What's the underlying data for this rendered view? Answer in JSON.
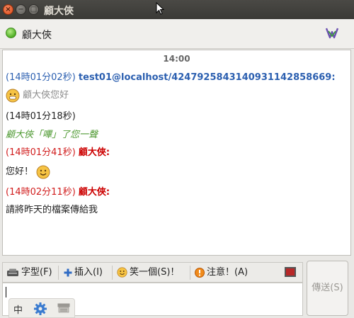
{
  "window": {
    "title": "顧大俠",
    "close_glyph": "×",
    "minimize_glyph": "−",
    "maximize_glyph": "□"
  },
  "contact": {
    "name": "顧大俠",
    "status_color": "#4fae25"
  },
  "chat": {
    "time_separator": "14:00",
    "messages": [
      {
        "stamp": "(14時01分02秒)",
        "sender": "test01@localhost/4247925843140931142858669:",
        "color": "blue"
      },
      {
        "text": "顧大俠您好",
        "emoticon": "grin",
        "color": "grey"
      },
      {
        "stamp": "(14時01分18秒)",
        "color": "dark"
      },
      {
        "text": "顧大俠「嗶」了您一聲",
        "color": "green"
      },
      {
        "stamp": "(14時01分41秒)",
        "sender": "顧大俠:",
        "color": "red"
      },
      {
        "text": "您好！",
        "emoticon": "smile"
      },
      {
        "stamp": "(14時02分11秒)",
        "sender": "顧大俠:",
        "color": "red"
      },
      {
        "text": "請將昨天的檔案傳給我"
      }
    ]
  },
  "toolbar": {
    "font_label": "字型(F)",
    "insert_label": "插入(I)",
    "smiley_label": "笑一個(S)！",
    "attention_label": "注意！(A)",
    "color_value": "#b82828"
  },
  "send": {
    "label": "傳送(S)"
  },
  "ime": {
    "mode_label": "中"
  },
  "icons": {
    "font": "font-icon",
    "insert": "plus-icon",
    "smiley": "smiley-icon",
    "attention": "warning-icon",
    "settings": "gear-icon",
    "keyboard": "keyboard-icon",
    "logo": "app-logo-icon"
  }
}
